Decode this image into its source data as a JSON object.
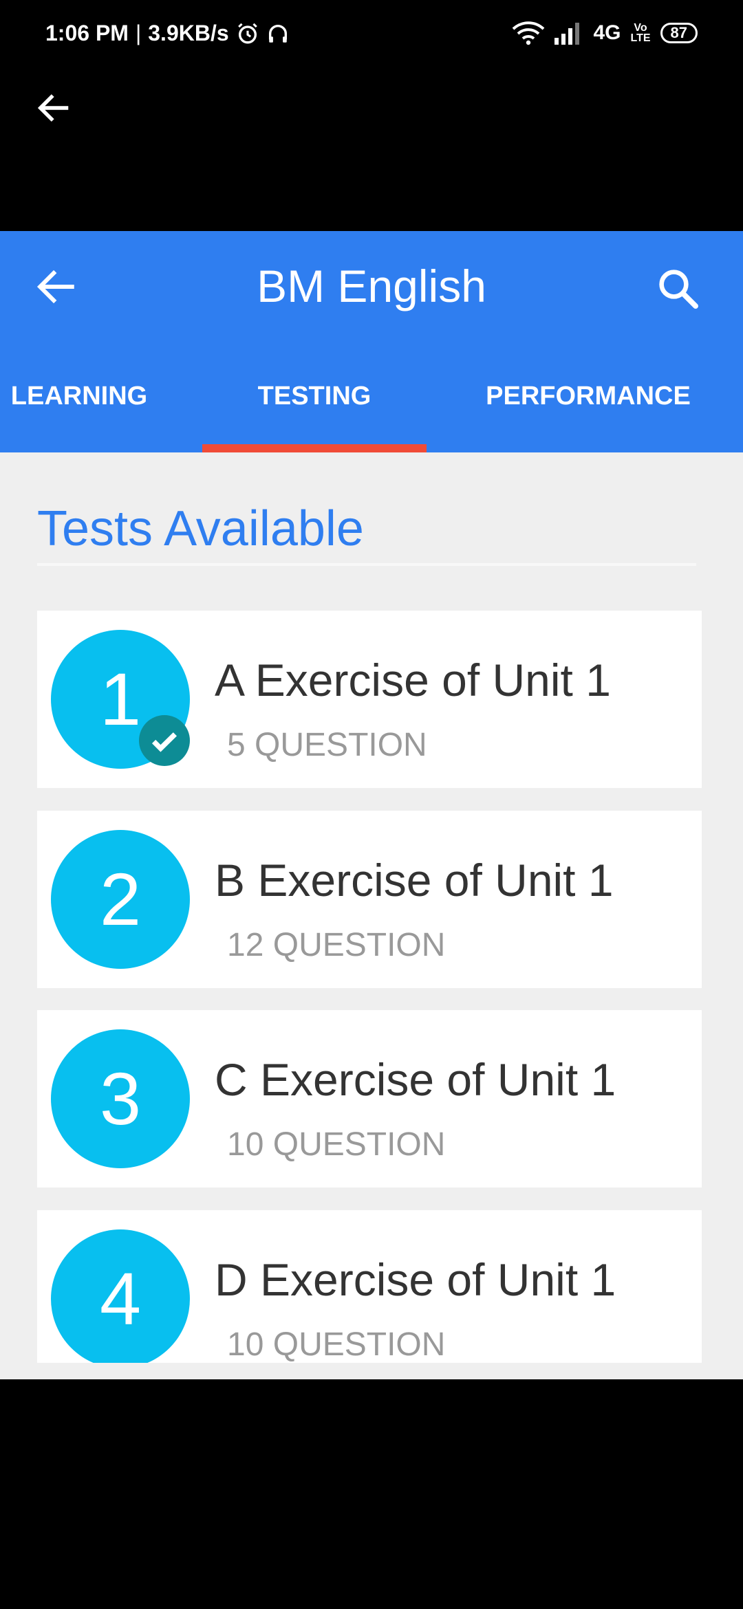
{
  "status_bar": {
    "time": "1:06 PM",
    "separator": "|",
    "speed": "3.9KB/s",
    "network": "4G",
    "volte_top": "Vo",
    "volte_bottom": "LTE",
    "battery": "87",
    "icons": [
      "alarm-icon",
      "headset-icon",
      "wifi-icon",
      "signal-icon"
    ]
  },
  "app_bar": {
    "title": "BM English",
    "color": "#2f7ef0",
    "icons": [
      "back-arrow-icon",
      "search-icon"
    ]
  },
  "tabs": {
    "items": [
      {
        "label": "LEARNING"
      },
      {
        "label": "TESTING"
      },
      {
        "label": "PERFORMANCE"
      }
    ],
    "selected": "TESTING",
    "indicator_color": "#f04b37"
  },
  "section": {
    "title": "Tests Available"
  },
  "tests": [
    {
      "number": "1",
      "title": "A Exercise of Unit 1",
      "subtitle": "5 QUESTION",
      "completed": true
    },
    {
      "number": "2",
      "title": "B Exercise of Unit 1",
      "subtitle": "12 QUESTION",
      "completed": false
    },
    {
      "number": "3",
      "title": "C Exercise of Unit 1",
      "subtitle": "10 QUESTION",
      "completed": false
    },
    {
      "number": "4",
      "title": "D Exercise of Unit 1",
      "subtitle": "10 QUESTION",
      "completed": false
    }
  ],
  "colors": {
    "circle": "#08bfef",
    "check_badge": "#0d8c95"
  }
}
